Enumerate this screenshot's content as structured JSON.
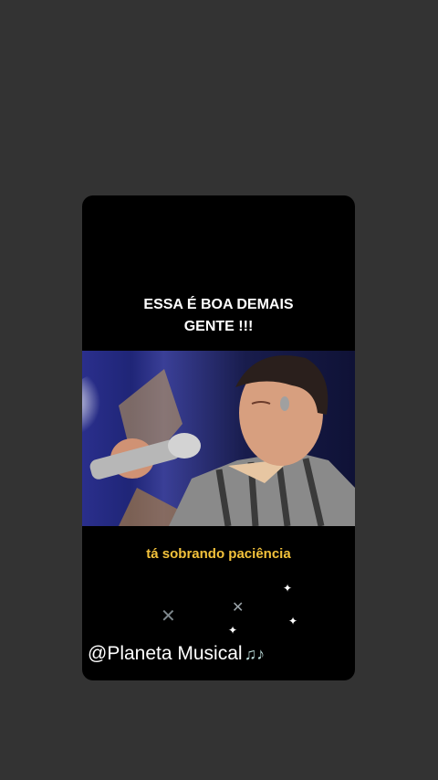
{
  "story": {
    "headline_line1": "ESSA É BOA DEMAIS",
    "headline_line2": "GENTE !!!",
    "subtitle": "tá sobrando paciência",
    "watermark": "@Planeta Musical",
    "watermark_icon": "music-notes-icon"
  },
  "colors": {
    "page_background": "#333333",
    "card_background": "#000000",
    "subtitle_color": "#f3c23b",
    "headline_color": "#ffffff"
  }
}
